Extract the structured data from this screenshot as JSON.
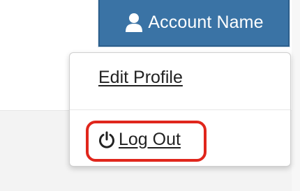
{
  "header": {
    "account_label": "Account Name",
    "account_icon": "user-icon",
    "accent_color": "#3a73a5"
  },
  "menu": {
    "edit_profile_label": "Edit Profile",
    "logout_label": "Log Out",
    "logout_icon": "power-icon",
    "highlight_color": "#e0261c"
  }
}
